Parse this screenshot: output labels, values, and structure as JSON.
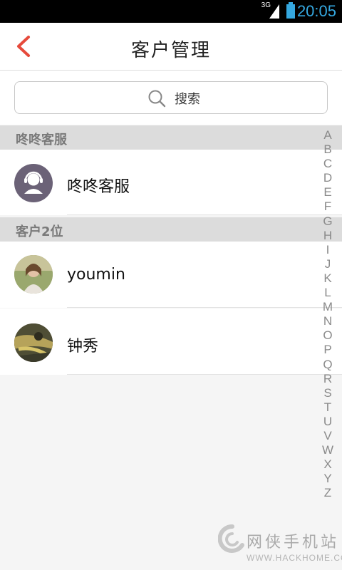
{
  "status_bar": {
    "network": "3G",
    "time": "20:05"
  },
  "header": {
    "title": "客户管理"
  },
  "search": {
    "label": "搜索"
  },
  "sections": [
    {
      "title": "咚咚客服",
      "rows": [
        {
          "name": "咚咚客服"
        }
      ]
    },
    {
      "title": "客户2位",
      "rows": [
        {
          "name": "youmin"
        },
        {
          "name": "钟秀"
        }
      ]
    }
  ],
  "alphabet_index": [
    "A",
    "B",
    "C",
    "D",
    "E",
    "F",
    "G",
    "H",
    "I",
    "J",
    "K",
    "L",
    "M",
    "N",
    "O",
    "P",
    "Q",
    "R",
    "S",
    "T",
    "U",
    "V",
    "W",
    "X",
    "Y",
    "Z"
  ],
  "watermark": {
    "brand": "网侠手机站",
    "url": "WWW.HACKHOME.COM"
  },
  "colors": {
    "accent": "#e64a3c",
    "status_time": "#35a8e0",
    "section_bg": "#dcdcdc"
  }
}
